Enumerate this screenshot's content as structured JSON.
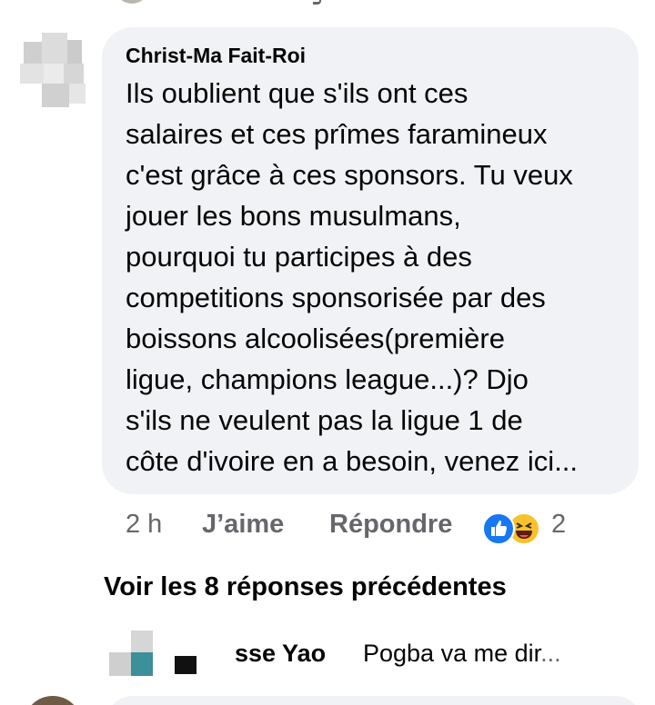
{
  "comment": {
    "author": "Christ-Ma Fait-Roi",
    "text_lines": [
      "Ils oublient que s'ils ont ces",
      "salaires et ces prîmes faramineux",
      "c'est grâce à ces sponsors. Tu veux",
      "jouer les bons musulmans,",
      "pourquoi tu participes à des",
      "competitions sponsorisée par des",
      "boissons alcoolisées(première",
      "ligue, champions league...)? Djo",
      "s'ils ne veulent pas la ligue 1 de",
      "côte d'ivoire en a besoin, venez ici..."
    ],
    "time": "2 h",
    "like_label": "J’aime",
    "reply_label": "Répondre",
    "reaction_count": "2",
    "reaction_icons": [
      "like-reaction-icon",
      "haha-reaction-icon"
    ],
    "colors": {
      "bubble": "#f0f2f5",
      "meta_text": "#65676b",
      "like_blue": "#1877f2",
      "haha_yellow": "#f7c22c"
    }
  },
  "replies": {
    "view_previous_label": "Voir les 8 réponses précédentes",
    "preview": {
      "name": "sse Yao",
      "snippet": "Pogba va me dir",
      "ellipsis": "..."
    }
  }
}
